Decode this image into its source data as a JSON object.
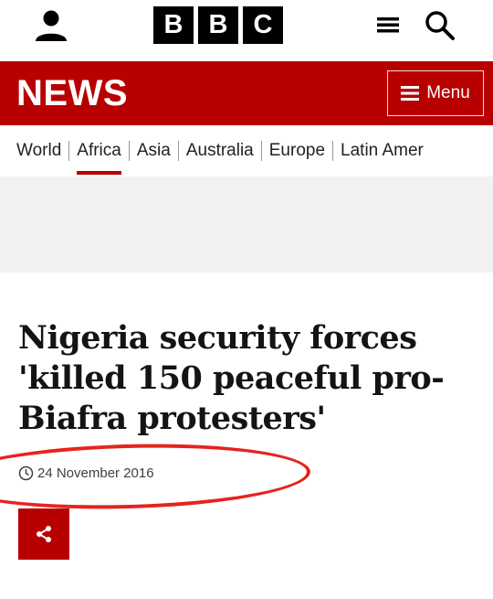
{
  "header": {
    "logo_letters": [
      "B",
      "B",
      "C"
    ],
    "account_icon": "person-icon",
    "hamburger_icon": "hamburger-icon",
    "search_icon": "search-icon"
  },
  "newsbar": {
    "brand": "NEWS",
    "menu_label": "Menu",
    "brand_color": "#b80000"
  },
  "nav": {
    "items": [
      {
        "label": "World",
        "active": false
      },
      {
        "label": "Africa",
        "active": true
      },
      {
        "label": "Asia",
        "active": false
      },
      {
        "label": "Australia",
        "active": false
      },
      {
        "label": "Europe",
        "active": false
      },
      {
        "label": "Latin Amer",
        "active": false
      }
    ]
  },
  "article": {
    "headline": "Nigeria security forces 'killed 150 peaceful pro-Biafra protesters'",
    "date": "24 November 2016"
  },
  "annotation": {
    "color": "#e6231e"
  }
}
